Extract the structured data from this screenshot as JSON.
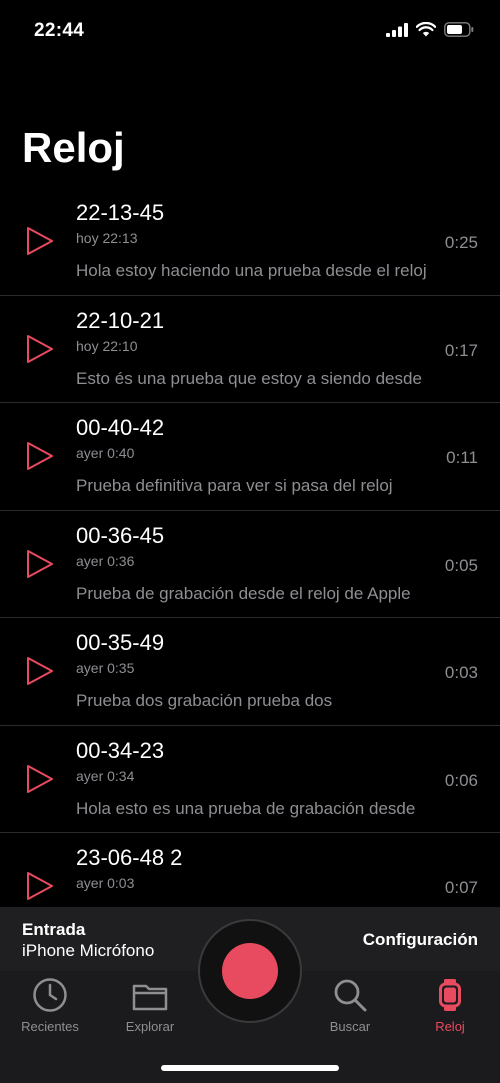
{
  "status_bar": {
    "time": "22:44"
  },
  "page": {
    "title": "Reloj"
  },
  "recordings": [
    {
      "name": "22-13-45",
      "date": "hoy 22:13",
      "duration": "0:25",
      "transcript": "Hola estoy haciendo una prueba desde el reloj"
    },
    {
      "name": "22-10-21",
      "date": "hoy 22:10",
      "duration": "0:17",
      "transcript": "Esto és una prueba que estoy a siendo desde"
    },
    {
      "name": "00-40-42",
      "date": "ayer 0:40",
      "duration": "0:11",
      "transcript": "Prueba definitiva para ver si pasa del reloj"
    },
    {
      "name": "00-36-45",
      "date": "ayer 0:36",
      "duration": "0:05",
      "transcript": "Prueba de grabación desde el reloj de Apple"
    },
    {
      "name": "00-35-49",
      "date": "ayer 0:35",
      "duration": "0:03",
      "transcript": "Prueba dos grabación prueba dos"
    },
    {
      "name": "00-34-23",
      "date": "ayer 0:34",
      "duration": "0:06",
      "transcript": "Hola esto es una prueba de grabación desde"
    },
    {
      "name": "23-06-48 2",
      "date": "ayer 0:03",
      "duration": "0:07",
      "transcript": ""
    }
  ],
  "input": {
    "label": "Entrada",
    "value": "iPhone Micrófono"
  },
  "config_label": "Configuración",
  "tabs": [
    {
      "label": "Recientes",
      "icon": "clock-icon"
    },
    {
      "label": "Explorar",
      "icon": "folder-icon"
    },
    {
      "label": "Buscar",
      "icon": "search-icon"
    },
    {
      "label": "Reloj",
      "icon": "watch-icon"
    }
  ],
  "colors": {
    "accent": "#e84a5f",
    "secondary_text": "#8e8e93",
    "background": "#000000"
  }
}
